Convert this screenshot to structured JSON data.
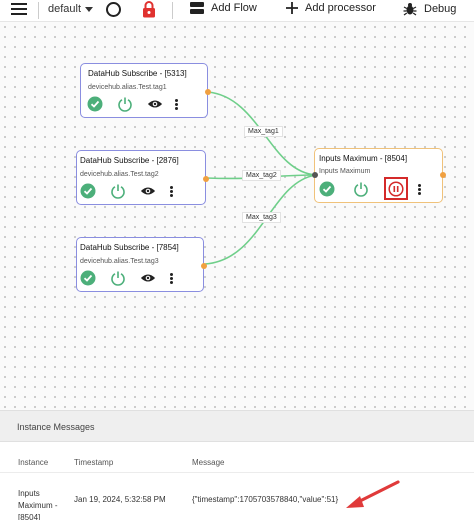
{
  "toolbar": {
    "flow_name": "default",
    "add_flow_label": "Add Flow",
    "add_processor_label": "Add processor",
    "debug_label": "Debug"
  },
  "nodes": [
    {
      "title": "DataHub Subscribe - [5313]",
      "subtitle": "devicehub.alias.Test.tag1"
    },
    {
      "title": "DataHub Subscribe - [2876]",
      "subtitle": "devicehub.alias.Test.tag2"
    },
    {
      "title": "DataHub Subscribe - [7854]",
      "subtitle": "devicehub.alias.Test.tag3"
    }
  ],
  "processor": {
    "title": "Inputs Maximum - [8504]",
    "subtitle": "Inputs Maximum"
  },
  "edges": [
    "Max_tag1",
    "Max_tag2",
    "Max_tag3"
  ],
  "colors": {
    "check": "#4caf7a",
    "power": "#4caf7a",
    "pause": "#d42a2a",
    "lock": "#e0322f",
    "highlight": "#d42a2a",
    "arrow": "#e03a3a"
  },
  "messages": {
    "title": "Instance Messages",
    "columns": [
      "Instance",
      "Timestamp",
      "Message"
    ],
    "rows": [
      {
        "instance": "Inputs Maximum - [8504]",
        "timestamp": "Jan 19, 2024, 5:32:58 PM",
        "message": "{\"timestamp\":1705703578840,\"value\":51}"
      }
    ]
  }
}
